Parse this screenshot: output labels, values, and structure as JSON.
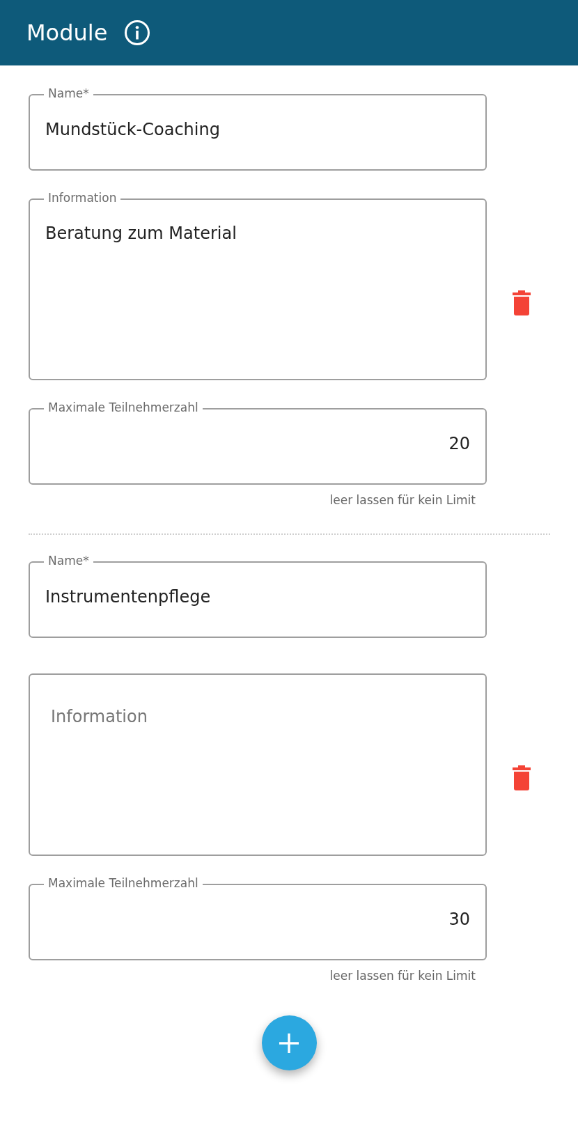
{
  "header": {
    "title": "Module"
  },
  "modules": [
    {
      "name": {
        "label": "Name*",
        "value": "Mundstück-Coaching"
      },
      "information": {
        "label": "Information",
        "value": "Beratung zum Material"
      },
      "max_participants": {
        "label": "Maximale Teilnehmerzahl",
        "value": "20",
        "hint": "leer lassen für kein Limit"
      }
    },
    {
      "name": {
        "label": "Name*",
        "value": "Instrumentenpflege"
      },
      "information": {
        "placeholder": "Information"
      },
      "max_participants": {
        "label": "Maximale Teilnehmerzahl",
        "value": "30",
        "hint": "leer lassen für kein Limit"
      }
    }
  ]
}
